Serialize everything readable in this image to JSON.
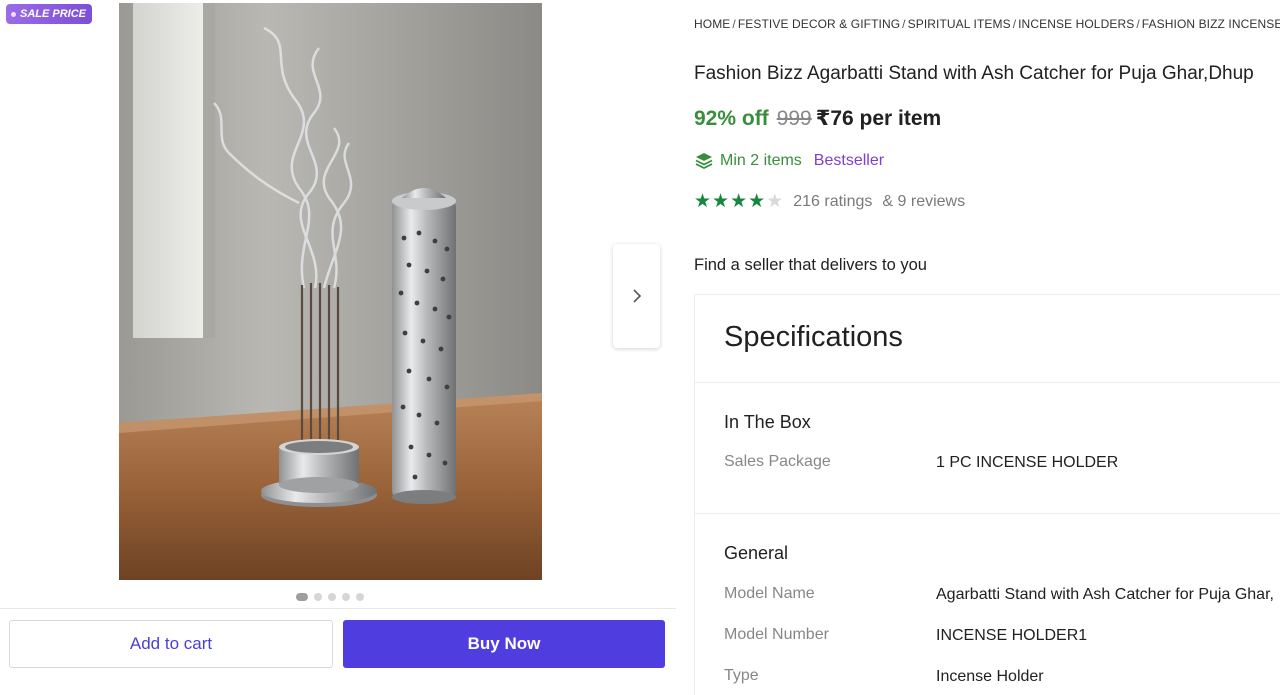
{
  "badge": {
    "label": "SALE PRICE"
  },
  "gallery": {
    "image_count": 5,
    "active_index": 0
  },
  "actions": {
    "add_to_cart": "Add to cart",
    "buy_now": "Buy Now"
  },
  "breadcrumb": [
    "HOME",
    "FESTIVE DECOR & GIFTING",
    "SPIRITUAL ITEMS",
    "INCENSE HOLDERS",
    "FASHION BIZZ INCENSE H"
  ],
  "product": {
    "title": "Fashion Bizz Agarbatti Stand with Ash Catcher for Puja Ghar,Dhup",
    "discount": "92% off",
    "mrp": "999",
    "price": "₹76 per item",
    "min_items": "Min 2 items",
    "bestseller": "Bestseller",
    "rating_stars": 4,
    "ratings": "216 ratings",
    "reviews": "& 9 reviews",
    "seller_prompt": "Find a seller that delivers to you"
  },
  "specifications": {
    "heading": "Specifications",
    "sections": [
      {
        "title": "In The Box",
        "rows": [
          {
            "label": "Sales Package",
            "value": "1 PC INCENSE HOLDER"
          }
        ]
      },
      {
        "title": "General",
        "rows": [
          {
            "label": "Model Name",
            "value": "Agarbatti Stand with Ash Catcher for Puja Ghar,"
          },
          {
            "label": "Model Number",
            "value": "INCENSE HOLDER1"
          },
          {
            "label": "Type",
            "value": "Incense Holder"
          }
        ]
      }
    ]
  },
  "colors": {
    "discount_green": "#388e3c",
    "bestseller_purple": "#7c3fd0",
    "buy_button": "#4f3de0",
    "star_green": "#14883e"
  }
}
